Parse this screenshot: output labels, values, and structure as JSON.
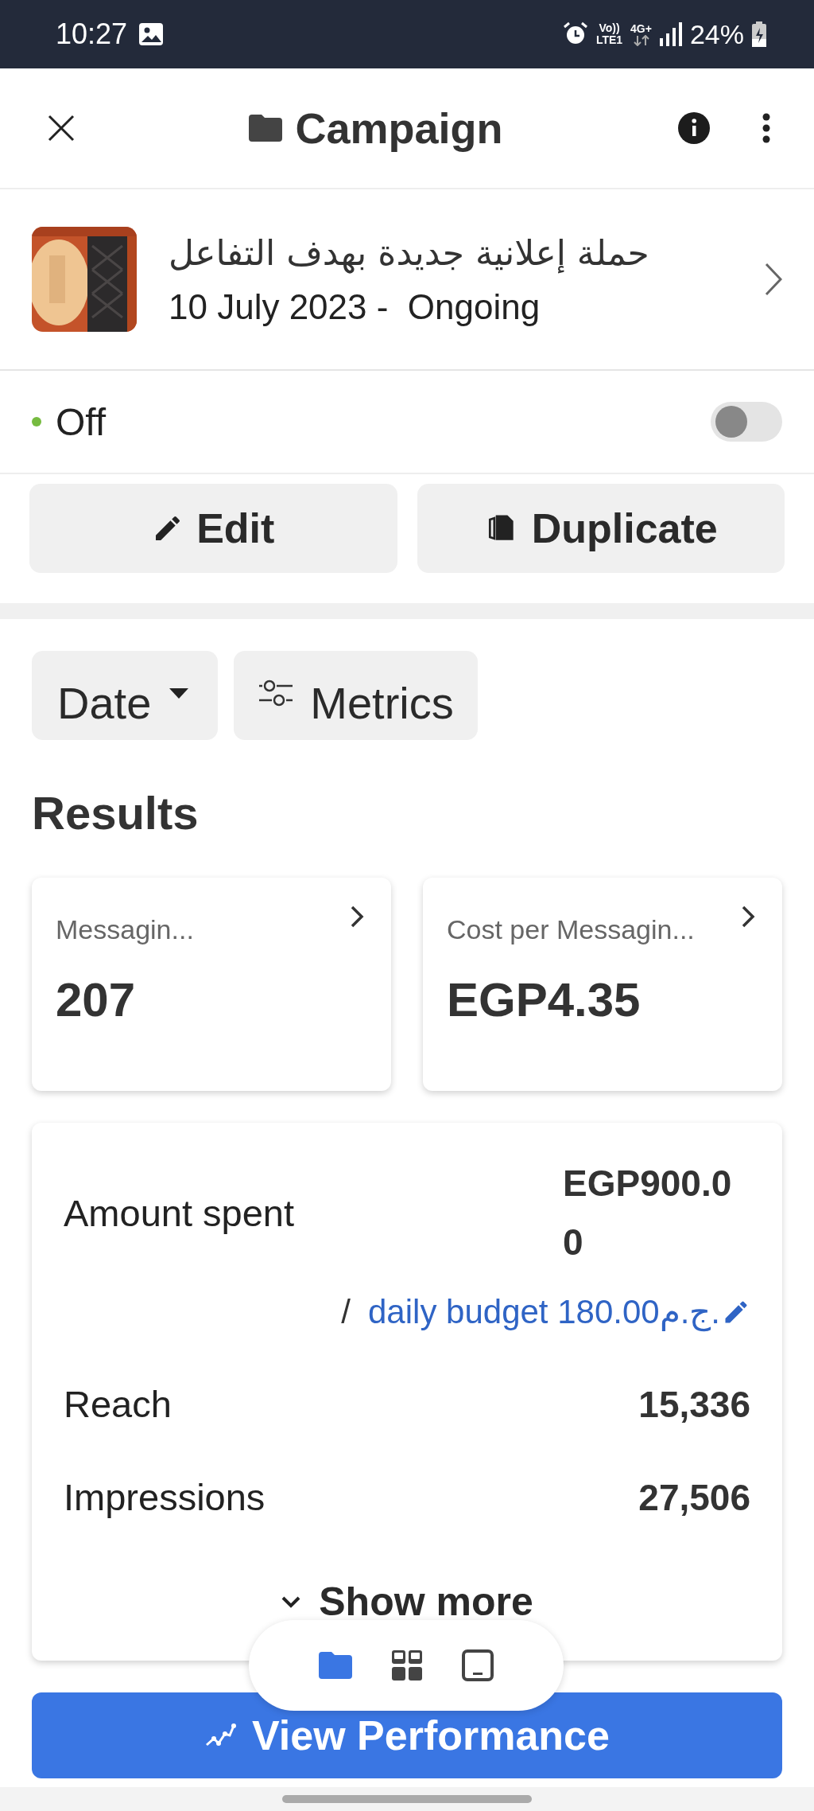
{
  "status_bar": {
    "time": "10:27",
    "volte_top": "Vo))",
    "volte_bottom": "LTE1",
    "data_type": "4G+",
    "battery": "24%"
  },
  "header": {
    "title": "Campaign"
  },
  "campaign": {
    "name": "حملة إعلانية جديدة بهدف التفاعل",
    "dates": "10 July 2023 -  Ongoing"
  },
  "status": {
    "label": "Off",
    "on": false
  },
  "actions": [
    {
      "kind": "edit",
      "label": "Edit"
    },
    {
      "kind": "duplicate",
      "label": "Duplicate"
    }
  ],
  "filters": [
    {
      "kind": "dropdown",
      "label": "Date"
    },
    {
      "kind": "metrics",
      "label": "Metrics"
    }
  ],
  "results": {
    "heading": "Results",
    "cards": [
      {
        "label": "Messagin...",
        "value": "207"
      },
      {
        "label": "Cost per Messagin...",
        "value": "EGP4.35"
      }
    ],
    "amount_spent": {
      "label": "Amount spent",
      "value": "EGP900.00",
      "separator": "/",
      "budget": "daily budget 180.00ج.م."
    },
    "rows": [
      {
        "label": "Reach",
        "value": "15,336"
      },
      {
        "label": "Impressions",
        "value": "27,506"
      }
    ],
    "show_more": "Show more"
  },
  "view_performance": "View Performance",
  "bottom_nav": [
    {
      "kind": "folder",
      "selected": true
    },
    {
      "kind": "grid",
      "selected": false
    },
    {
      "kind": "tablet",
      "selected": false
    }
  ]
}
